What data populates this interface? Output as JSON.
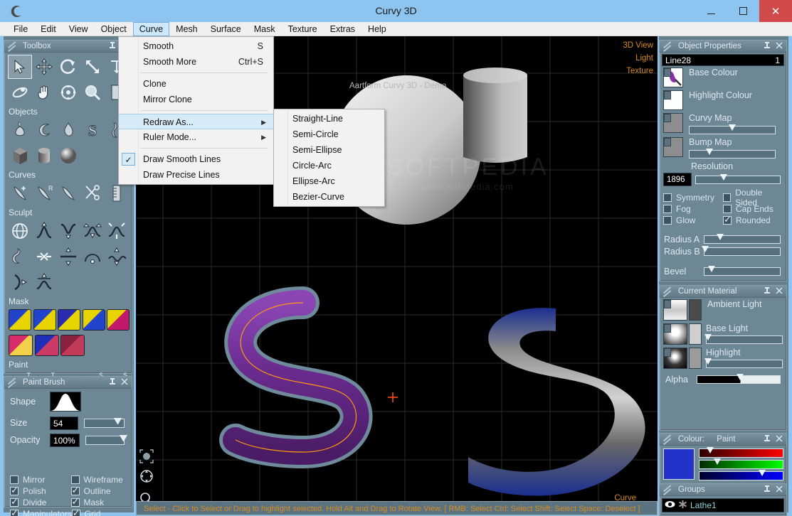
{
  "window": {
    "title": "Curvy 3D",
    "app_icon": "curvy-logo-icon",
    "minimize": "–",
    "maximize": "▢",
    "close": "✕"
  },
  "menubar": {
    "items": [
      {
        "label": "File",
        "active": false
      },
      {
        "label": "Edit",
        "active": false
      },
      {
        "label": "View",
        "active": false
      },
      {
        "label": "Object",
        "active": false
      },
      {
        "label": "Curve",
        "active": true
      },
      {
        "label": "Mesh",
        "active": false
      },
      {
        "label": "Surface",
        "active": false
      },
      {
        "label": "Mask",
        "active": false
      },
      {
        "label": "Texture",
        "active": false
      },
      {
        "label": "Extras",
        "active": false
      },
      {
        "label": "Help",
        "active": false
      }
    ]
  },
  "curve_menu": {
    "items": [
      {
        "label": "Smooth",
        "shortcut": "S",
        "type": "item"
      },
      {
        "label": "Smooth More",
        "shortcut": "Ctrl+S",
        "type": "item"
      },
      {
        "type": "separator"
      },
      {
        "label": "Clone",
        "shortcut": "",
        "type": "item"
      },
      {
        "label": "Mirror Clone",
        "shortcut": "",
        "type": "item"
      },
      {
        "type": "separator"
      },
      {
        "label": "Redraw As...",
        "shortcut": "",
        "type": "submenu",
        "highlighted": true
      },
      {
        "label": "Ruler Mode...",
        "shortcut": "",
        "type": "submenu"
      },
      {
        "type": "separator"
      },
      {
        "label": "Draw Smooth Lines",
        "shortcut": "",
        "type": "check",
        "checked": true
      },
      {
        "label": "Draw Precise Lines",
        "shortcut": "",
        "type": "item"
      }
    ]
  },
  "redraw_submenu": {
    "items": [
      {
        "label": "Straight-Line"
      },
      {
        "label": "Semi-Circle"
      },
      {
        "label": "Semi-Ellipse"
      },
      {
        "label": "Circle-Arc"
      },
      {
        "label": "Ellipse-Arc"
      },
      {
        "label": "Bezier-Curve"
      }
    ]
  },
  "toolbox": {
    "title": "Toolbox",
    "pin": "📌",
    "close": "✕",
    "sections": [
      {
        "label": "",
        "tools": [
          {
            "name": "select-arrow-tool",
            "glyph": "select",
            "selected": true
          },
          {
            "name": "move-tool",
            "glyph": "move"
          },
          {
            "name": "rotate-tool",
            "glyph": "rotate"
          },
          {
            "name": "scale-tool",
            "glyph": "scale"
          },
          {
            "name": "deform-tool",
            "glyph": "deform"
          }
        ]
      },
      {
        "label": "",
        "tools": [
          {
            "name": "orbit-tool",
            "glyph": "orbit"
          },
          {
            "name": "pan-hand-tool",
            "glyph": "hand"
          },
          {
            "name": "target-tool",
            "glyph": "target"
          },
          {
            "name": "zoom-magnifier-tool",
            "glyph": "magnifier"
          },
          {
            "name": "page-tool",
            "glyph": "page"
          }
        ]
      }
    ],
    "objects_label": "Objects",
    "objects_tools": [
      {
        "name": "lathe-object-tool",
        "glyph": "lathe"
      },
      {
        "name": "sweep-object-tool",
        "glyph": "sweep"
      },
      {
        "name": "blob-object-tool",
        "glyph": "blob"
      },
      {
        "name": "text-object-tool",
        "glyph": "text-s"
      },
      {
        "name": "tube-object-tool",
        "glyph": "tube"
      },
      {
        "name": "cube-primitive-tool",
        "glyph": "cube"
      },
      {
        "name": "cylinder-primitive-tool",
        "glyph": "cylinder"
      },
      {
        "name": "sphere-primitive-tool",
        "glyph": "sphere"
      }
    ],
    "curves_label": "Curves",
    "curves_tools": [
      {
        "name": "draw-curve-tool",
        "glyph": "pen-plus"
      },
      {
        "name": "redraw-curve-tool",
        "glyph": "pen-r"
      },
      {
        "name": "edit-curve-tool",
        "glyph": "pen"
      },
      {
        "name": "cut-curve-tool",
        "glyph": "scissors"
      },
      {
        "name": "ruler-tool",
        "glyph": "ruler"
      }
    ],
    "sculpt_label": "Sculpt",
    "sculpt_tools": [
      {
        "name": "sculpt-globe-tool",
        "glyph": "globe"
      },
      {
        "name": "pull-up-tool",
        "glyph": "pull-up"
      },
      {
        "name": "push-down-tool",
        "glyph": "push-down"
      },
      {
        "name": "spread-tool",
        "glyph": "spread"
      },
      {
        "name": "pinch-tool",
        "glyph": "pinch"
      },
      {
        "name": "snake-tool",
        "glyph": "snake"
      },
      {
        "name": "squeeze-tool",
        "glyph": "squeeze"
      },
      {
        "name": "flatten-tool",
        "glyph": "flatten"
      },
      {
        "name": "dome-tool",
        "glyph": "dome"
      },
      {
        "name": "ripple-tool",
        "glyph": "ripple"
      },
      {
        "name": "half-pinch-tool",
        "glyph": "half-pinch"
      },
      {
        "name": "smooth-arc-tool",
        "glyph": "smooth-arc"
      }
    ],
    "mask_label": "Mask",
    "mask_tools": [
      {
        "name": "mask-box-tool",
        "color1": "#2244cc",
        "color2": "#e8d400"
      },
      {
        "name": "mask-shape-tool",
        "color1": "#2244cc",
        "color2": "#e8d400"
      },
      {
        "name": "mask-gradient-tool",
        "color1": "#2c2cb0",
        "color2": "#e8d400"
      },
      {
        "name": "mask-blend-tool",
        "color1": "#e8d400",
        "color2": "#2244cc"
      },
      {
        "name": "mask-ring-tool",
        "color1": "#e8d400",
        "color2": "#c2186a"
      },
      {
        "name": "mask-radial-tool",
        "color1": "#d82b6a",
        "color2": "#f2d14a"
      },
      {
        "name": "mask-spot-tool",
        "color1": "#1f2fb8",
        "color2": "#cc3a66"
      },
      {
        "name": "mask-diagonal-tool",
        "color1": "#8b2340",
        "color2": "#c23c5a"
      }
    ],
    "paint_label": "Paint",
    "paint_tools": [
      {
        "name": "paint-brush-t-tool",
        "glyph": "brush",
        "badge": "T"
      },
      {
        "name": "paint-airbrush-t-tool",
        "glyph": "airbrush",
        "badge": "T"
      },
      {
        "name": "paint-stamp-tool",
        "glyph": "stamp",
        "badge": ""
      },
      {
        "name": "paint-brush-s-tool",
        "glyph": "brush",
        "badge": "S"
      },
      {
        "name": "paint-airbrush-s-tool",
        "glyph": "airbrush",
        "badge": "S"
      }
    ]
  },
  "paint_brush": {
    "title": "Paint Brush",
    "shape_label": "Shape",
    "shape_preview": "bell-curve-preview",
    "size_label": "Size",
    "size_value": "54",
    "size_slider_pct": 83,
    "opacity_label": "Opacity",
    "opacity_value": "100%",
    "opacity_slider_pct": 98,
    "checkboxes": [
      {
        "label": "Mirror",
        "checked": false
      },
      {
        "label": "Wireframe",
        "checked": false
      },
      {
        "label": "Polish",
        "checked": true
      },
      {
        "label": "Outline",
        "checked": true
      },
      {
        "label": "Divide",
        "checked": true
      },
      {
        "label": "Mask",
        "checked": true
      },
      {
        "label": "Manipulators",
        "checked": true
      },
      {
        "label": "Grid",
        "checked": true
      }
    ]
  },
  "viewport": {
    "title": "Aartform Curvy 3D - Demo",
    "watermark": "SOFTPEDIA",
    "watermark_sub": "www.softpedia.com",
    "side_labels": [
      "3D View",
      "Light",
      "Texture"
    ],
    "mode_label": "Curve",
    "corner_tools": [
      {
        "name": "object-select-viewport-icon"
      },
      {
        "name": "pan-viewport-icon"
      },
      {
        "name": "zoom-viewport-icon"
      }
    ],
    "objects": [
      {
        "name": "sphere-object",
        "type": "sphere"
      },
      {
        "name": "cylinder-object",
        "type": "cylinder"
      },
      {
        "name": "purple-s-tube-object",
        "type": "s-tube",
        "color": "#6a2b8f"
      },
      {
        "name": "blue-gray-s-ribbon-object",
        "type": "s-ribbon",
        "color": "#1e3a9b"
      }
    ]
  },
  "object_properties": {
    "title": "Object Properties",
    "object_name": "Line28",
    "object_index": "1",
    "base_colour_label": "Base Colour",
    "highlight_colour_label": "Highlight Colour",
    "curvy_map_label": "Curvy Map",
    "curvy_map_pct": 50,
    "bump_map_label": "Bump Map",
    "bump_map_pct": 23,
    "resolution_label": "Resolution",
    "resolution_value": "1896",
    "resolution_pct": 33,
    "checkboxes": [
      {
        "label": "Symmetry",
        "checked": false
      },
      {
        "label": "Double Sided",
        "checked": false
      },
      {
        "label": "Fog",
        "checked": false
      },
      {
        "label": "Cap Ends",
        "checked": false
      },
      {
        "label": "Glow",
        "checked": false
      },
      {
        "label": "Rounded",
        "checked": true
      }
    ],
    "radius_a_label": "Radius A",
    "radius_a_pct": 21,
    "radius_b_label": "Radius B",
    "radius_b_pct": 1,
    "bevel_label": "Bevel",
    "bevel_pct": 9
  },
  "current_material": {
    "title": "Current Material",
    "rows": [
      {
        "label": "Ambient Light",
        "slider": false
      },
      {
        "label": "Base Light",
        "slider": true,
        "pct": 2
      },
      {
        "label": "Highlight",
        "slider": true,
        "pct": 2
      }
    ],
    "alpha_label": "Alpha",
    "alpha_pct": 52
  },
  "colour_panel": {
    "title": "Colour:",
    "mode": "Paint",
    "current_color": "#2233cc",
    "red_pct": 13,
    "green_pct": 21,
    "blue_pct": 75,
    "value_picker": "value-gradient-picker",
    "hue_picker": "hue-saturation-picker"
  },
  "groups_panel": {
    "title": "Groups",
    "items": [
      {
        "label": "Lathe1",
        "visible_icon": "eye-icon",
        "type_icon": "asterisk-icon"
      }
    ]
  },
  "statusbar": {
    "text": "Select - Click to Select or Drag to highlight selected. Hold Alt and Drag to Rotate View. [ RMB: Select   Ctrl: Select   Shift: Select   Space: Deselect ]"
  }
}
